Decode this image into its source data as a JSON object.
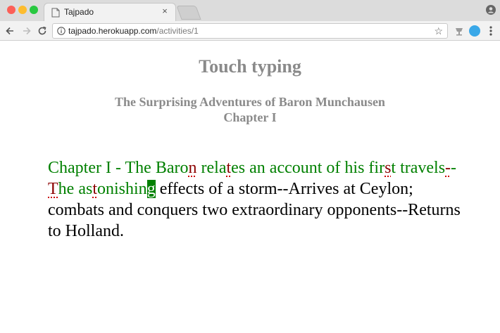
{
  "browser": {
    "tab_title": "Tajpado",
    "tab_close": "×",
    "url_host": "tajpado.herokuapp.com",
    "url_path": "/activities/1",
    "star": "☆",
    "traffic_colors": [
      "#fc5f57",
      "#fdbc2e",
      "#28c840"
    ]
  },
  "page": {
    "title": "Touch typing",
    "book_title": "The Surprising Adventures of Baron Munchausen",
    "chapter": "Chapter I"
  },
  "typing": {
    "colors": {
      "typed": "#008000",
      "error": "#8b0000",
      "untyped": "#000000",
      "cursor_bg": "#008000"
    },
    "segments": [
      {
        "text": "Chapter I - The Baro",
        "state": "typed"
      },
      {
        "text": "n",
        "state": "error"
      },
      {
        "text": " rela",
        "state": "typed"
      },
      {
        "text": "t",
        "state": "error"
      },
      {
        "text": "es an account of his fir",
        "state": "typed"
      },
      {
        "text": "s",
        "state": "error"
      },
      {
        "text": "t travels",
        "state": "typed"
      },
      {
        "text": "-",
        "state": "error"
      },
      {
        "text": "-",
        "state": "typed"
      },
      {
        "text": "T",
        "state": "error"
      },
      {
        "text": "he as",
        "state": "typed"
      },
      {
        "text": "t",
        "state": "error"
      },
      {
        "text": "onishin",
        "state": "typed"
      },
      {
        "text": "g",
        "state": "cursor"
      },
      {
        "text": " effects of a storm--Arrives at Ceylon; combats and conquers two extraordinary opponents--Returns to Holland.",
        "state": "untyped"
      }
    ]
  }
}
